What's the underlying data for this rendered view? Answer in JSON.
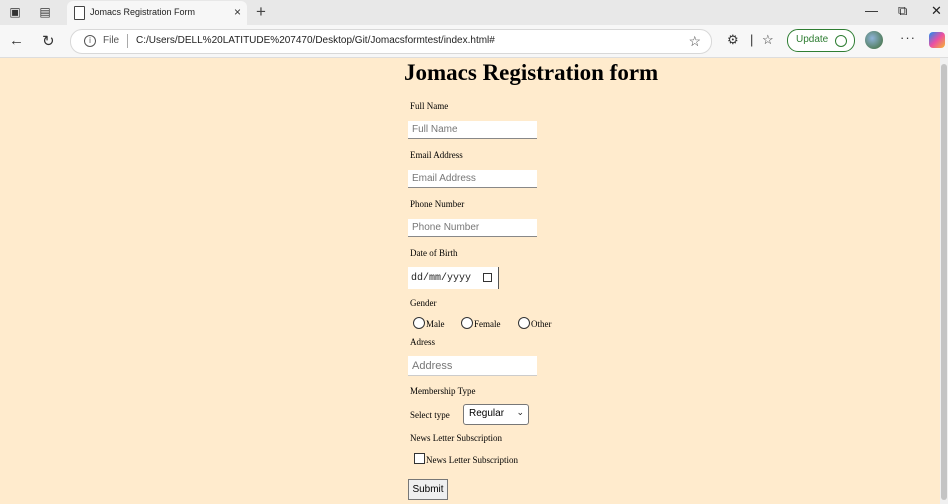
{
  "browser": {
    "tab_title": "Jomacs Registration Form",
    "tab_close": "×",
    "new_tab": "+",
    "file_label": "File",
    "url": "C:/Users/DELL%20LATITUDE%207470/Desktop/Git/Jomacsformtest/index.html#",
    "update_label": "Update",
    "more": "···",
    "window_controls": [
      "—",
      "⧉",
      "✕"
    ]
  },
  "form": {
    "title": "Jomacs Registration form",
    "full_name_label": "Full Name",
    "full_name_placeholder": "Full Name",
    "email_label": "Email Address",
    "email_placeholder": "Email Address",
    "phone_label": "Phone Number",
    "phone_placeholder": "Phone Number",
    "dob_label": "Date of Birth",
    "dob_value": "dd/mm/yyyy",
    "gender_label": "Gender",
    "gender_options": [
      "Male",
      "Female",
      "Other"
    ],
    "address_label": "Adress",
    "address_placeholder": "Address",
    "membership_label": "Membership Type",
    "select_label": "Select type",
    "select_value": "Regular",
    "newsletter_label": "News Letter Subscription",
    "newsletter_checkbox_label": "News Letter Subscription",
    "submit_label": "Submit"
  }
}
